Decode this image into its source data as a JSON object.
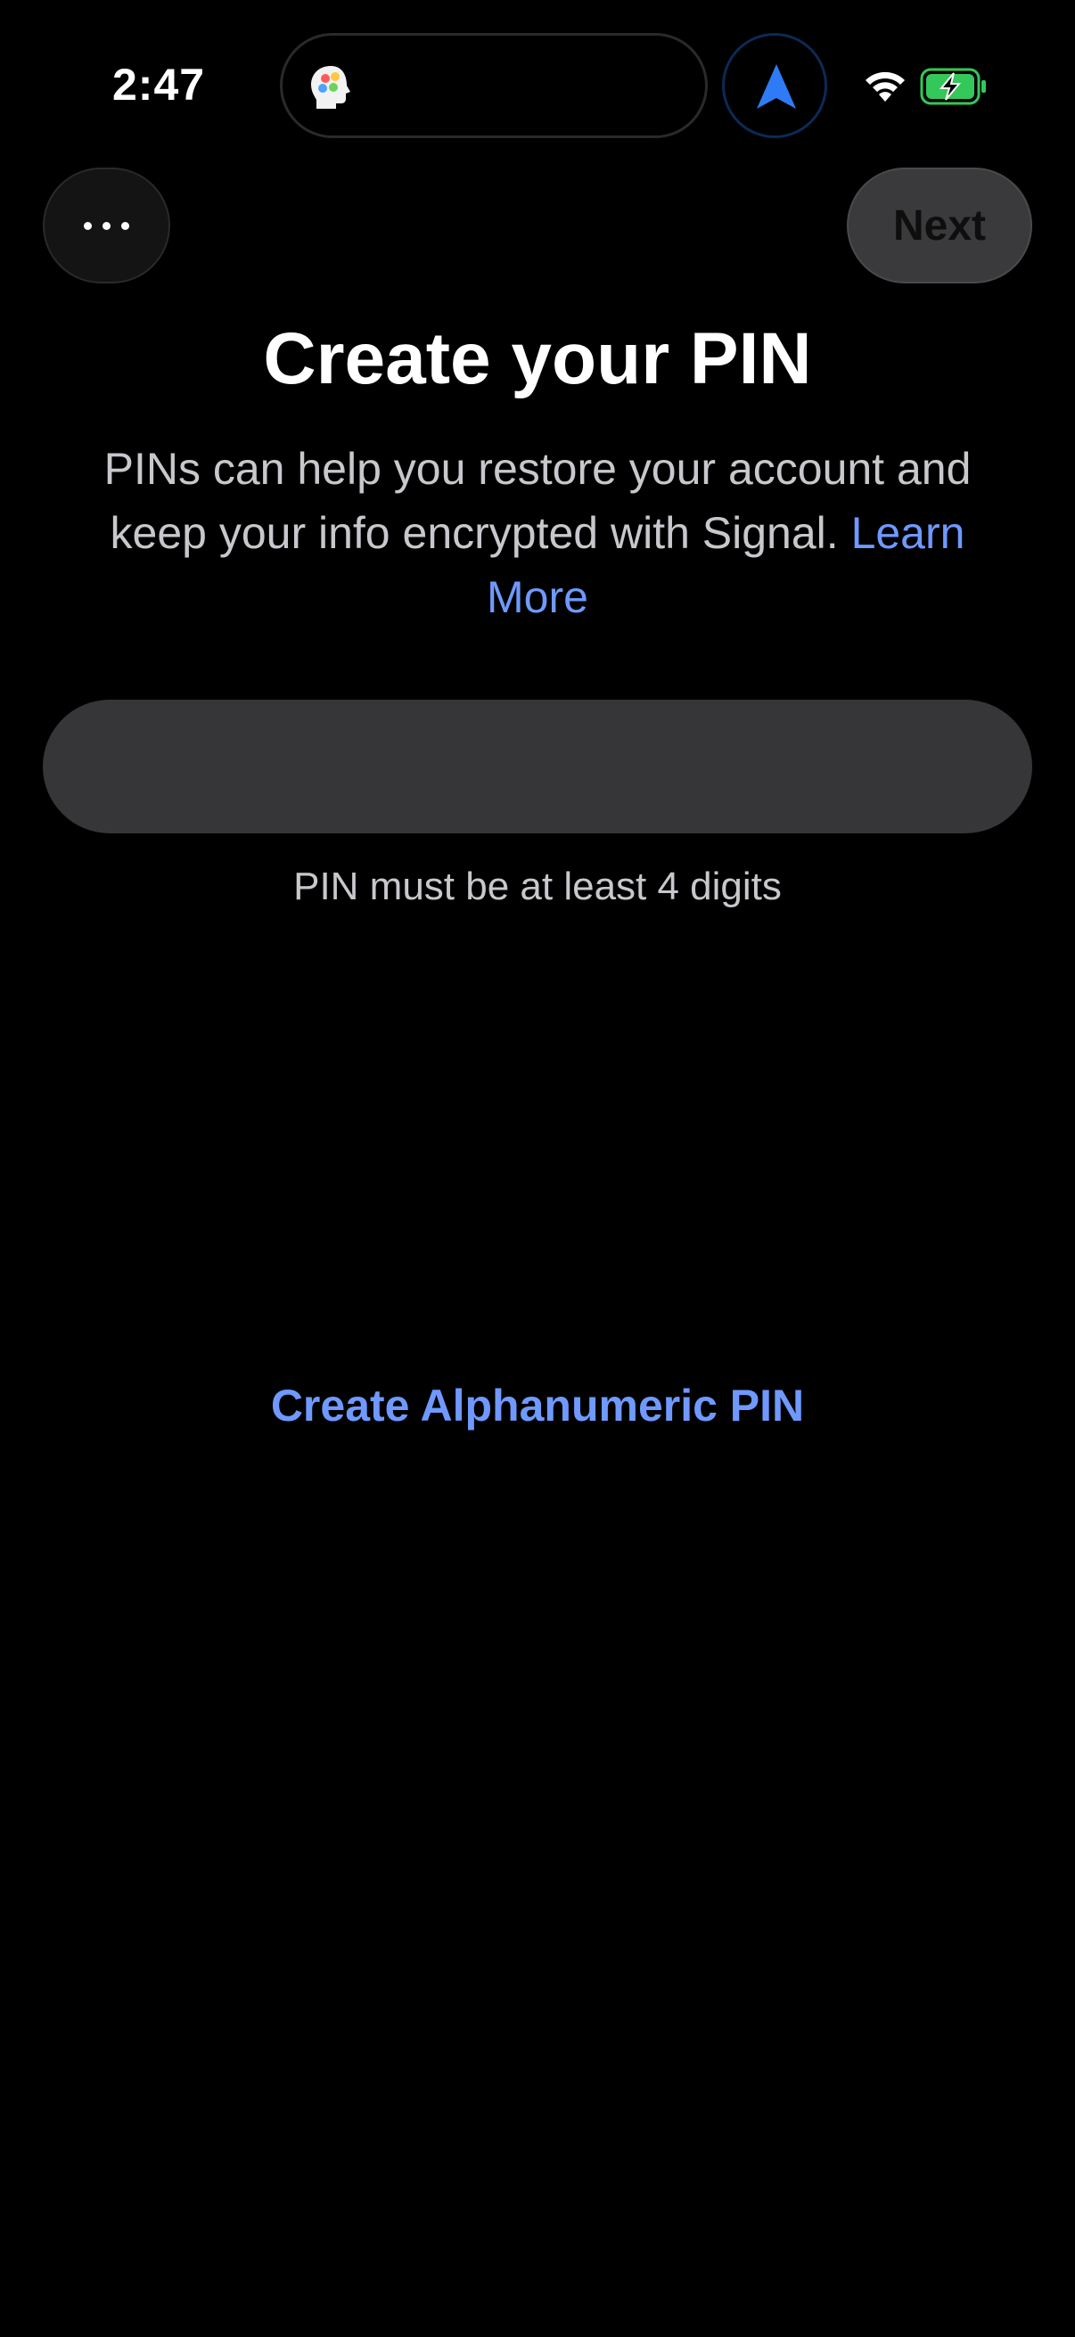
{
  "status_bar": {
    "time": "2:47"
  },
  "nav": {
    "more_icon": "ellipsis-icon",
    "next_label": "Next"
  },
  "content": {
    "title": "Create your PIN",
    "description_text": "PINs can help you restore your account and keep your info encrypted with Signal. ",
    "learn_more_label": "Learn More",
    "pin_value": "",
    "pin_hint": "PIN must be at least 4 digits",
    "alphanumeric_label": "Create Alphanumeric PIN"
  },
  "colors": {
    "background": "#000000",
    "link_blue": "#6f99ff",
    "input_fill": "#363639",
    "secondary_text": "#c7c7cc",
    "disabled_button": "#3a3a3c"
  }
}
